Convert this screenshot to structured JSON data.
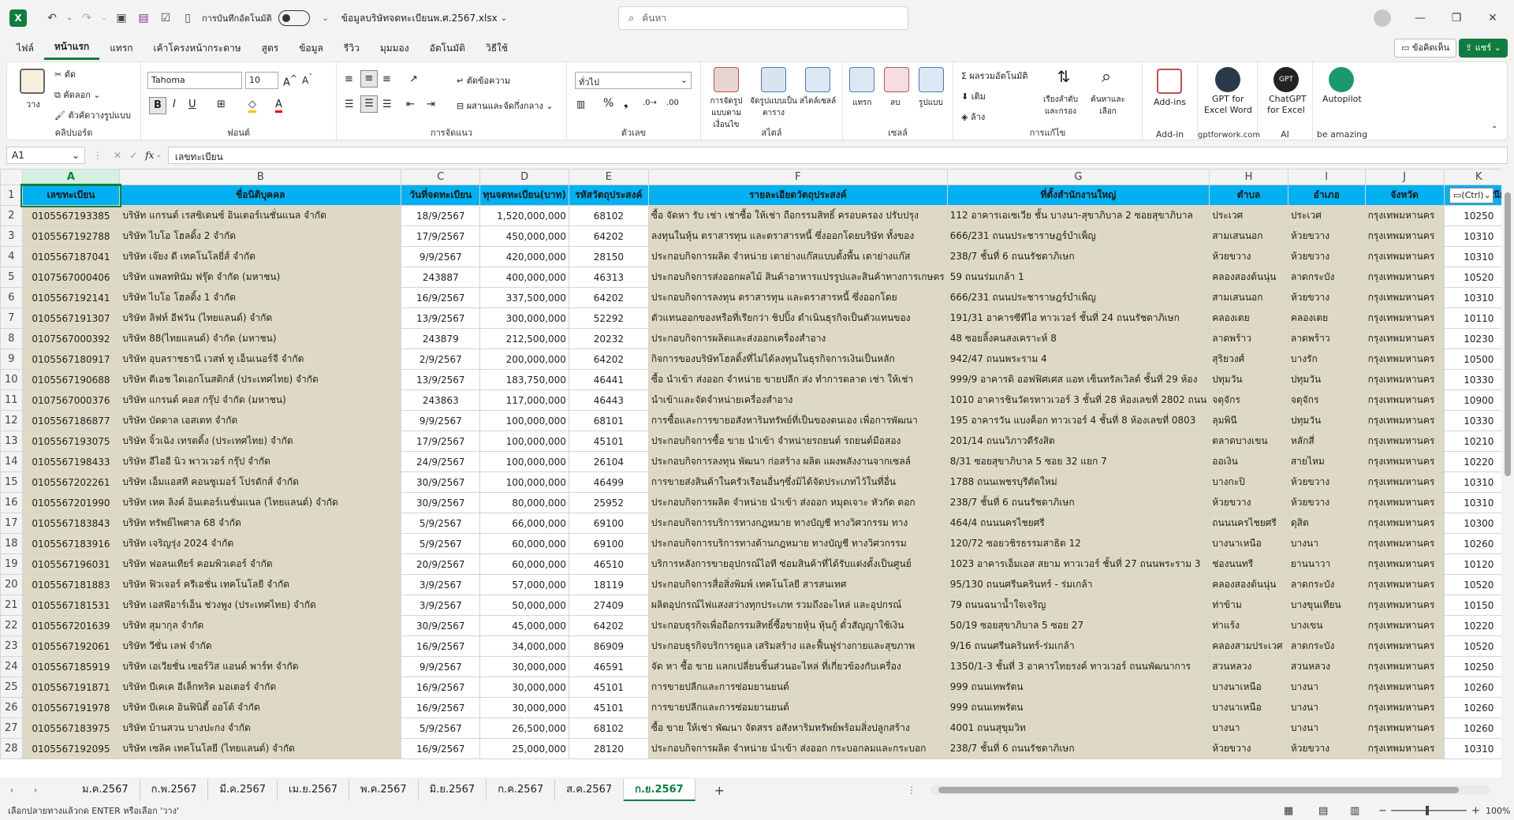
{
  "title": {
    "autosave_label": "การบันทึกอัตโนมัติ",
    "filename": "ข้อมูลบริษัทจดทะเบียนพ.ศ.2567.xlsx",
    "search_placeholder": "ค้นหา"
  },
  "menu": [
    "ไฟล์",
    "หน้าแรก",
    "แทรก",
    "เค้าโครงหน้ากระดาษ",
    "สูตร",
    "ข้อมูล",
    "รีวิว",
    "มุมมอง",
    "อัตโนมัติ",
    "วิธีใช้"
  ],
  "menu_active": "หน้าแรก",
  "top_right": {
    "comments": "ข้อคิดเห็น",
    "share": "แชร์"
  },
  "ribbon": {
    "clipboard": {
      "paste": "วาง",
      "cut": "ตัด",
      "copy": "คัดลอก",
      "format_painter": "ตัวคัดวางรูปแบบ",
      "label": "คลิปบอร์ด"
    },
    "font": {
      "name": "Tahoma",
      "size": "10",
      "label": "ฟอนต์"
    },
    "alignment": {
      "wrap": "ตัดข้อความ",
      "merge": "ผสานและจัดกึ่งกลาง",
      "label": "การจัดแนว"
    },
    "number": {
      "format": "ทั่วไป",
      "label": "ตัวเลข"
    },
    "styles": {
      "cond": "การจัดรูปแบบตามเงื่อนไข",
      "table": "จัดรูปแบบเป็นตาราง",
      "cell": "สไตล์เซลล์",
      "label": "สไตล์"
    },
    "cells": {
      "insert": "แทรก",
      "delete": "ลบ",
      "format": "รูปแบบ",
      "label": "เซลล์"
    },
    "editing": {
      "autosum": "ผลรวมอัตโนมัติ",
      "fill": "เติม",
      "clear": "ล้าง",
      "sort": "เรียงลำดับและกรอง",
      "find": "ค้นหาและเลือก",
      "label": "การแก้ไข"
    },
    "addins": {
      "addins": "Add-ins",
      "label": "Add-in"
    },
    "gpt_word": {
      "l1": "GPT for",
      "l2": "Excel Word",
      "label": "gptforwork.com"
    },
    "chatgpt": {
      "l1": "ChatGPT",
      "l2": "for Excel",
      "label": "AI"
    },
    "autopilot": {
      "l1": "Autopilot",
      "label": "be amazing"
    }
  },
  "formula": {
    "cell_ref": "A1",
    "fx": "fx",
    "value": "เลขทะเบียน"
  },
  "columns": [
    "A",
    "B",
    "C",
    "D",
    "E",
    "F",
    "G",
    "H",
    "I",
    "J",
    "K"
  ],
  "headers": [
    "เลขทะเบียน",
    "ชื่อนิติบุคคล",
    "วันที่จดทะเบียน",
    "ทุนจดทะเบียน(บาท)",
    "รหัสวัตถุประสงค์",
    "รายละเอียดวัตถุประสงค์",
    "ที่ตั้งสำนักงานใหญ่",
    "ตำบล",
    "อำเภอ",
    "จังหวัด",
    "รหัสไปรษณีย์"
  ],
  "paste_tag": "(Ctrl)",
  "rows": [
    [
      "0105567193385",
      "บริษัท แกรนด์ เรสซิเดนซ์ อินเตอร์เนชั่นแนล จำกัด",
      "18/9/2567",
      "1,520,000,000",
      "68102",
      "ซื้อ จัดหา รับ เช่า เช่าซื้อ ให้เช่า ถือกรรมสิทธิ์ ครอบครอง ปรับปรุง",
      "112  อาคารเอเซเวีย ชั้น บางนา-สุขาภิบาล 2 ซอยสุขาภิบาล",
      "ประเวศ",
      "ประเวศ",
      "กรุงเทพมหานคร",
      "10250"
    ],
    [
      "0105567192788",
      "บริษัท ไบโอ โฮลดิ้ง 2 จำกัด",
      "17/9/2567",
      "450,000,000",
      "64202",
      "ลงทุนในหุ้น ตราสารทุน และตราสารหนี้ ซึ่งออกโดยบริษัท ทั้งของ",
      "666/231  ถนนประชาราษฎร์บำเพ็ญ",
      "สามเสนนอก",
      "ห้วยขวาง",
      "กรุงเทพมหานคร",
      "10310"
    ],
    [
      "0105567187041",
      "บริษัท เจ๊ยง ดี เทคโนโลยี่ส์ จำกัด",
      "9/9/2567",
      "420,000,000",
      "28150",
      "ประกอบกิจการผลิต จำหน่าย เตาย่างแก๊สแบบตั้งพื้น เตาย่างแก๊ส",
      "238/7  ชั้นที่ 6 ถนนรัชดาภิเษก",
      "ห้วยขวาง",
      "ห้วยขวาง",
      "กรุงเทพมหานคร",
      "10310"
    ],
    [
      "0107567000406",
      "บริษัท แพลททินัม ฟรุ๊ต จำกัด (มหาชน)",
      "243887",
      "400,000,000",
      "46313",
      "ประกอบกิจการส่งออกผลไม้ สินค้าอาหารแปรรูปและสินค้าทางการเกษตร",
      "59  ถนนร่มเกล้า 1",
      "คลองสองต้นนุ่น",
      "ลาดกระบัง",
      "กรุงเทพมหานคร",
      "10520"
    ],
    [
      "0105567192141",
      "บริษัท ไบโอ โฮลดิ้ง 1 จำกัด",
      "16/9/2567",
      "337,500,000",
      "64202",
      "ประกอบกิจการลงทุน ตราสารทุน และตราสารหนี้ ซึ่งออกโดย",
      "666/231  ถนนประชาราษฎร์บำเพ็ญ",
      "สามเสนนอก",
      "ห้วยขวาง",
      "กรุงเทพมหานคร",
      "10310"
    ],
    [
      "0105567191307",
      "บริษัท ลิฟท์ อีฟวัน (ไทยแลนด์) จำกัด",
      "13/9/2567",
      "300,000,000",
      "52292",
      "ตัวแทนออกของหรือที่เรียกว่า ชิปปิ้ง ดำเนินธุรกิจเป็นตัวแทนของ",
      "191/31  อาคารซีทีไอ ทาวเวอร์ ชั้นที่ 24 ถนนรัชดาภิเษก",
      "คลองเตย",
      "คลองเตย",
      "กรุงเทพมหานคร",
      "10110"
    ],
    [
      "0107567000392",
      "บริษัท 88(ไทยแลนด์) จำกัด (มหาชน)",
      "243879",
      "212,500,000",
      "20232",
      "ประกอบกิจการผลิตและส่งออกเครื่องสำอาง",
      "48  ซอยลิ้งคนสงเคราะห์ 8",
      "ลาดพร้าว",
      "ลาดพร้าว",
      "กรุงเทพมหานคร",
      "10230"
    ],
    [
      "0105567180917",
      "บริษัท อุบลราชธานี เวสท์ ทู เอ็นเนอร์จี จำกัด",
      "2/9/2567",
      "200,000,000",
      "64202",
      "กิจการของบริษัทโฮลดิ้งที่ไม่ได้ลงทุนในธุรกิจการเงินเป็นหลัก",
      "942/47  ถนนพระราม 4",
      "สุริยวงศ์",
      "บางรัก",
      "กรุงเทพมหานคร",
      "10500"
    ],
    [
      "0105567190688",
      "บริษัท ดีเอช ไดเอกโนสติกส์ (ประเทศไทย) จำกัด",
      "13/9/2567",
      "183,750,000",
      "46441",
      "ซื้อ นำเข้า ส่งออก จำหน่าย ขายปลีก ส่ง ทำการตลาด เช่า ให้เช่า",
      "999/9  อาคารดิ ออฟฟิศเศส แอท เซ็นทรัลเวิลด์ ชั้นที่ 29  ห้อง",
      "ปทุมวัน",
      "ปทุมวัน",
      "กรุงเทพมหานคร",
      "10330"
    ],
    [
      "0107567000376",
      "บริษัท แกรนด์ คอส กรุ๊ป จำกัด (มหาชน)",
      "243863",
      "117,000,000",
      "46443",
      "นำเข้าและจัดจำหน่ายเครื่องสำอาง",
      "1010  อาคารชินวัตรทาวเวอร์ 3 ชั้นที่ 28  ห้องเลขที่ 2802 ถนน",
      "จตุจักร",
      "จตุจักร",
      "กรุงเทพมหานคร",
      "10900"
    ],
    [
      "0105567186877",
      "บริษัท บัดดาล เอสเตท จำกัด",
      "9/9/2567",
      "100,000,000",
      "68101",
      "การซื้อและการขายอสังหาริมทรัพย์ที่เป็นของตนเอง เพื่อการพัฒนา",
      "195  อาคารวัน แบงค็อก ทาวเวอร์ 4 ชั้นที่ 8  ห้องเลขที่ 0803",
      "ลุมพินี",
      "ปทุมวัน",
      "กรุงเทพมหานคร",
      "10330"
    ],
    [
      "0105567193075",
      "บริษัท จิ้วเฉิง เทรดดิ้ง (ประเทศไทย) จำกัด",
      "17/9/2567",
      "100,000,000",
      "45101",
      "ประกอบกิจการซื้อ ขาย นำเข้า จำหน่ายรถยนต์ รถยนต์มือสอง",
      "201/14  ถนนวิภาวดีรังสิต",
      "ตลาดบางเขน",
      "หลักสี่",
      "กรุงเทพมหานคร",
      "10210"
    ],
    [
      "0105567198433",
      "บริษัท อีไออี นิว พาวเวอร์ กรุ๊ป จำกัด",
      "24/9/2567",
      "100,000,000",
      "26104",
      "ประกอบกิจการลงทุน พัฒนา ก่อสร้าง ผลิต แผงพลังงานจากเซลล์",
      "8/31  ซอยสุขาภิบาล 5 ซอย 32 แยก 7",
      "ออเงิน",
      "สายไหม",
      "กรุงเทพมหานคร",
      "10220"
    ],
    [
      "0105567202261",
      "บริษัท เอ็มแอสที คอนซูเมอร์ โปรดักส์ จำกัด",
      "30/9/2567",
      "100,000,000",
      "46499",
      "การขายส่งสินค้าในครัวเรือนอื่นๆซึ่งมิได้จัดประเภทไว้ในที่อื่น",
      "1788  ถนนเพชรบุรีตัดใหม่",
      "บางกะปิ",
      "ห้วยขวาง",
      "กรุงเทพมหานคร",
      "10310"
    ],
    [
      "0105567201990",
      "บริษัท เทค ลิงค์ อินเตอร์เนชั่นแนล (ไทยแลนด์) จำกัด",
      "30/9/2567",
      "80,000,000",
      "25952",
      "ประกอบกิจการผลิต จำหน่าย นำเข้า ส่งออก หมุดเจาะ หัวกัด ดอก",
      "238/7  ชั้นที่ 6 ถนนรัชดาภิเษก",
      "ห้วยขวาง",
      "ห้วยขวาง",
      "กรุงเทพมหานคร",
      "10310"
    ],
    [
      "0105567183843",
      "บริษัท ทรัพย์ไพศาล 68 จำกัด",
      "5/9/2567",
      "66,000,000",
      "69100",
      "ประกอบกิจการบริการทางกฎหมาย ทางบัญชี ทางวิศวกรรม ทาง",
      "464/4  ถนนนครไชยศรี",
      "ถนนนครไชยศรี",
      "ดุสิต",
      "กรุงเทพมหานคร",
      "10300"
    ],
    [
      "0105567183916",
      "บริษัท เจริญรุ่ง 2024 จำกัด",
      "5/9/2567",
      "60,000,000",
      "69100",
      "ประกอบกิจการบริการทางด้านกฎหมาย ทางบัญชี ทางวิศวกรรม",
      "120/72  ซอยวชิรธรรมสาธิต 12",
      "บางนาเหนือ",
      "บางนา",
      "กรุงเทพมหานคร",
      "10260"
    ],
    [
      "0105567196031",
      "บริษัท ฟอลนเทียร์ คอมพิวเตอร์ จำกัด",
      "20/9/2567",
      "60,000,000",
      "46510",
      "บริการหลังการขายอุปกรณ์ไอที ซ่อมสินค้าที่ได้รับแต่งตั้งเป็นศูนย์",
      "1023  อาคารเอ็มเอส สยาม ทาวเวอร์ ชั้นที่ 27 ถนนพระราม 3",
      "ช่องนนทรี",
      "ยานนาวา",
      "กรุงเทพมหานคร",
      "10120"
    ],
    [
      "0105567181883",
      "บริษัท ฟิวเจอร์ ครีเอชั่น เทคโนโลยี จำกัด",
      "3/9/2567",
      "57,000,000",
      "18119",
      "ประกอบกิจการสื่อสิ่งพิมพ์ เทคโนโลยี สารสนเทศ",
      "95/130  ถนนศรีนครินทร์ - ร่มเกล้า",
      "คลองสองต้นนุ่น",
      "ลาดกระบัง",
      "กรุงเทพมหานคร",
      "10520"
    ],
    [
      "0105567181531",
      "บริษัท เอสพีอาร์เอ็น ช่วงพูง (ประเทศไทย) จำกัด",
      "3/9/2567",
      "50,000,000",
      "27409",
      "ผลิตอุปกรณ์ไฟแสงสว่างทุกประเภท รวมถึงอะไหล่ และอุปกรณ์",
      "79  ถนนฉนาน้ำใจเจริญ",
      "ท่าข้าม",
      "บางขุนเทียน",
      "กรุงเทพมหานคร",
      "10150"
    ],
    [
      "0105567201639",
      "บริษัท สุมากุล   จำกัด",
      "30/9/2567",
      "45,000,000",
      "64202",
      "ประกอบธุรกิจเพื่อถือกรรมสิทธิ์ซื้อขายหุ้น หุ้นกู้ ตั๋วสัญญาใช้เงิน",
      "50/19  ซอยสุขาภิบาล 5 ซอย 27",
      "ท่าแร้ง",
      "บางเขน",
      "กรุงเทพมหานคร",
      "10220"
    ],
    [
      "0105567192061",
      "บริษัท วีซั่น เลฟ จำกัด",
      "16/9/2567",
      "34,000,000",
      "86909",
      "ประกอบธุรกิจบริการดูแล เสริมสร้าง และฟื้นฟูร่างกายและสุขภาพ",
      "9/16  ถนนศรีนครินทร์-ร่มเกล้า",
      "คลองสามประเวศ",
      "ลาดกระบัง",
      "กรุงเทพมหานคร",
      "10520"
    ],
    [
      "0105567185919",
      "บริษัท เอเวียชั่น เซอร์วิส แอนด์ พาร์ท จำกัด",
      "9/9/2567",
      "30,000,000",
      "46591",
      "จัด หา ซื้อ ขาย แลกเปลี่ยนชิ้นส่วนอะไหล่ ที่เกี่ยวข้องกับเครื่อง",
      "1350/1-3 ชั้นที่ 3  อาคารไทยรงค์ ทาวเวอร์ ถนนพัฒนาการ",
      "สวนหลวง",
      "สวนหลวง",
      "กรุงเทพมหานคร",
      "10250"
    ],
    [
      "0105567191871",
      "บริษัท บีเคเค อีเล็กทริค มอเตอร์ จำกัด",
      "16/9/2567",
      "30,000,000",
      "45101",
      "การขายปลีกและการซ่อมยานยนต์",
      "999  ถนนเทพรัตน",
      "บางนาเหนือ",
      "บางนา",
      "กรุงเทพมหานคร",
      "10260"
    ],
    [
      "0105567191978",
      "บริษัท บีเคเค อินฟินิตี้ ออโต้ จำกัด",
      "16/9/2567",
      "30,000,000",
      "45101",
      "การขายปลีกและการซ่อมยานยนต์",
      "999  ถนนเทพรัตน",
      "บางนาเหนือ",
      "บางนา",
      "กรุงเทพมหานคร",
      "10260"
    ],
    [
      "0105567183975",
      "บริษัท บ้านสวน บางปะกง จำกัด",
      "5/9/2567",
      "26,500,000",
      "68102",
      "ซื้อ ขาย ให้เช่า พัฒนา จัดสรร อสังหาริมทรัพย์พร้อมสิ่งปลูกสร้าง",
      "4001  ถนนสุขุมวิท",
      "บางนา",
      "บางนา",
      "กรุงเทพมหานคร",
      "10260"
    ],
    [
      "0105567192095",
      "บริษัท เซลิค เทคโนโลยี (ไทยแลนด์) จำกัด",
      "16/9/2567",
      "25,000,000",
      "28120",
      "ประกอบกิจการผลิต จำหน่าย นำเข้า ส่งออก กระบอกลมและกระบอก",
      "238/7  ชั้นที่ 6 ถนนรัชดาภิเษก",
      "ห้วยขวาง",
      "ห้วยขวาง",
      "กรุงเทพมหานคร",
      "10310"
    ]
  ],
  "sheets": [
    "ม.ค.2567",
    "ก.พ.2567",
    "มี.ค.2567",
    "เม.ย.2567",
    "พ.ค.2567",
    "มิ.ย.2567",
    "ก.ค.2567",
    "ส.ค.2567",
    "ก.ย.2567"
  ],
  "active_sheet": "ก.ย.2567",
  "status": {
    "message": "เลือกปลายทางแล้วกด ENTER หรือเลือก 'วาง'",
    "zoom": "100%"
  }
}
